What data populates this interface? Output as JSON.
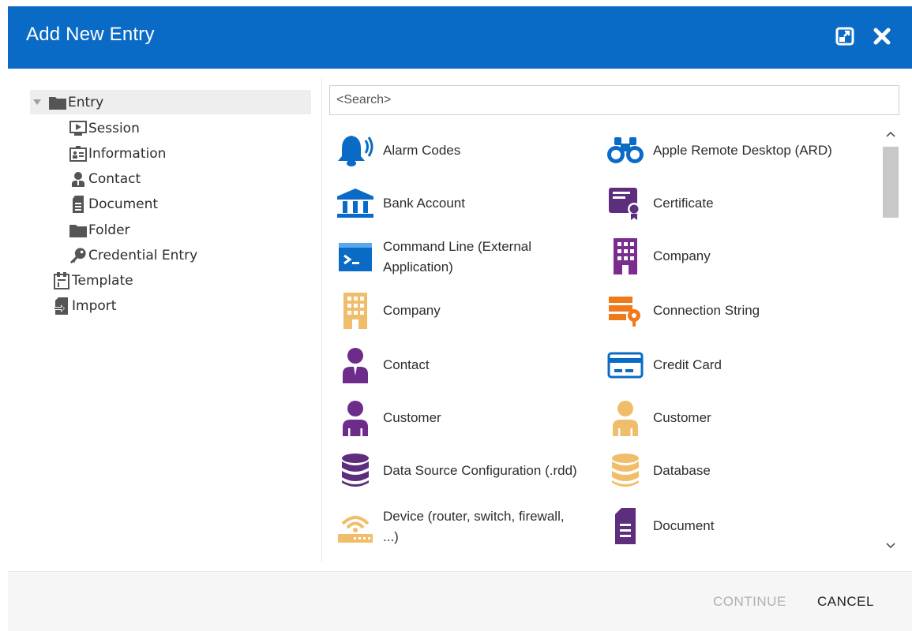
{
  "dialog": {
    "title": "Add New Entry",
    "accent_color": "#0a6bc7"
  },
  "tree": {
    "items": [
      {
        "label": "Entry",
        "icon": "folder-icon",
        "selected": true,
        "expanded": true
      },
      {
        "label": "Session",
        "icon": "session-icon"
      },
      {
        "label": "Information",
        "icon": "information-icon"
      },
      {
        "label": "Contact",
        "icon": "contact-icon"
      },
      {
        "label": "Document",
        "icon": "document-icon"
      },
      {
        "label": "Folder",
        "icon": "folder-icon"
      },
      {
        "label": "Credential Entry",
        "icon": "key-icon"
      },
      {
        "label": "Template",
        "icon": "template-icon"
      },
      {
        "label": "Import",
        "icon": "import-icon"
      }
    ]
  },
  "search": {
    "placeholder": "<Search>",
    "value": ""
  },
  "entry_types": [
    {
      "label": "Alarm Codes",
      "icon": "alarm-bell-icon",
      "color": "#0a6bc7"
    },
    {
      "label": "Apple Remote Desktop (ARD)",
      "icon": "binoculars-icon",
      "color": "#0a6bc7"
    },
    {
      "label": "Bank Account",
      "icon": "bank-icon",
      "color": "#0a6bc7"
    },
    {
      "label": "Certificate",
      "icon": "certificate-icon",
      "color": "#5d2d7e"
    },
    {
      "label": "Command Line (External Application)",
      "icon": "command-line-icon",
      "color": "#0a6bc7"
    },
    {
      "label": "Company",
      "icon": "building-icon",
      "color": "#7b2d8f"
    },
    {
      "label": "Company",
      "icon": "building-icon",
      "color": "#f0be6a"
    },
    {
      "label": "Connection String",
      "icon": "connection-string-icon",
      "color": "#f07a1a"
    },
    {
      "label": "Contact",
      "icon": "contact-icon",
      "color": "#6d2c8a"
    },
    {
      "label": "Credit Card",
      "icon": "credit-card-icon",
      "color": "#0a6bc7"
    },
    {
      "label": "Customer",
      "icon": "customer-icon",
      "color": "#6d2c8a"
    },
    {
      "label": "Customer",
      "icon": "customer-icon",
      "color": "#f0be6a"
    },
    {
      "label": "Data Source Configuration (.rdd)",
      "icon": "database-icon",
      "color": "#5d2d7e"
    },
    {
      "label": "Database",
      "icon": "database-icon",
      "color": "#f0be6a"
    },
    {
      "label": "Device (router, switch, firewall, ...)",
      "icon": "router-icon",
      "color": "#f0be6a"
    },
    {
      "label": "Document",
      "icon": "document-icon",
      "color": "#5d2d7e"
    }
  ],
  "footer": {
    "continue_label": "CONTINUE",
    "cancel_label": "CANCEL"
  }
}
